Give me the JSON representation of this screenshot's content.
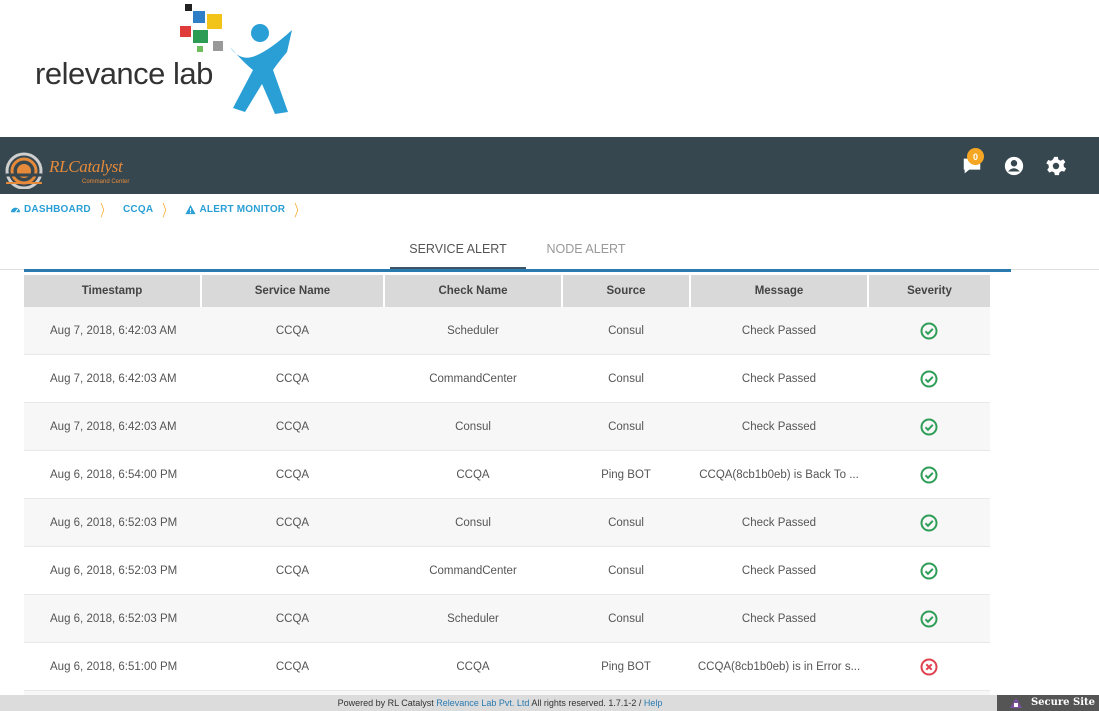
{
  "logo": {
    "text": "relevance lab"
  },
  "brand": {
    "name": "RLCatalyst",
    "subtitle": "Command Center"
  },
  "header": {
    "notification_count": "0"
  },
  "breadcrumb": [
    {
      "label": "DASHBOARD",
      "icon": "dashboard-icon"
    },
    {
      "label": "CCQA"
    },
    {
      "label": "ALERT MONITOR",
      "icon": "warning-icon"
    }
  ],
  "tabs": [
    {
      "label": "SERVICE ALERT",
      "active": true
    },
    {
      "label": "NODE ALERT",
      "active": false
    }
  ],
  "table": {
    "columns": [
      "Timestamp",
      "Service Name",
      "Check Name",
      "Source",
      "Message",
      "Severity"
    ],
    "rows": [
      {
        "timestamp": "Aug 7, 2018, 6:42:03 AM",
        "service": "CCQA",
        "check": "Scheduler",
        "source": "Consul",
        "message": "Check Passed",
        "severity": "ok"
      },
      {
        "timestamp": "Aug 7, 2018, 6:42:03 AM",
        "service": "CCQA",
        "check": "CommandCenter",
        "source": "Consul",
        "message": "Check Passed",
        "severity": "ok"
      },
      {
        "timestamp": "Aug 7, 2018, 6:42:03 AM",
        "service": "CCQA",
        "check": "Consul",
        "source": "Consul",
        "message": "Check Passed",
        "severity": "ok"
      },
      {
        "timestamp": "Aug 6, 2018, 6:54:00 PM",
        "service": "CCQA",
        "check": "CCQA",
        "source": "Ping BOT",
        "message": "CCQA(8cb1b0eb) is Back To ...",
        "severity": "ok"
      },
      {
        "timestamp": "Aug 6, 2018, 6:52:03 PM",
        "service": "CCQA",
        "check": "Consul",
        "source": "Consul",
        "message": "Check Passed",
        "severity": "ok"
      },
      {
        "timestamp": "Aug 6, 2018, 6:52:03 PM",
        "service": "CCQA",
        "check": "CommandCenter",
        "source": "Consul",
        "message": "Check Passed",
        "severity": "ok"
      },
      {
        "timestamp": "Aug 6, 2018, 6:52:03 PM",
        "service": "CCQA",
        "check": "Scheduler",
        "source": "Consul",
        "message": "Check Passed",
        "severity": "ok"
      },
      {
        "timestamp": "Aug 6, 2018, 6:51:00 PM",
        "service": "CCQA",
        "check": "CCQA",
        "source": "Ping BOT",
        "message": "CCQA(8cb1b0eb) is in Error s...",
        "severity": "error"
      },
      {
        "timestamp": "",
        "service": "",
        "check": "",
        "source": "",
        "message": "",
        "severity": "ok"
      }
    ]
  },
  "footer": {
    "prefix": "Powered by RL Catalyst ",
    "company": "Relevance Lab Pvt. Ltd",
    "rights": " All rights reserved. 1.7.1-2 / ",
    "help": "Help",
    "secure": "Secure Site"
  },
  "colors": {
    "ok": "#2e9e57",
    "error": "#e0424f",
    "accent": "#2a9fd6",
    "topbar": "#37474f"
  }
}
